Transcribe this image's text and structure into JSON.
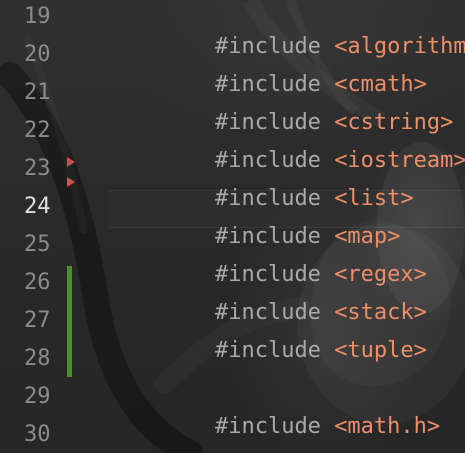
{
  "editor": {
    "theme": {
      "background": "#2a2a2a",
      "line_number": "#8b8b8b",
      "current_line_number": "#e0e0e0",
      "directive": "#a9a9a9",
      "header": "#ec8f67",
      "marker": "#d94b4b",
      "change_bar": "#4f8f2a"
    },
    "lines": [
      {
        "number": "19",
        "directive": "#include",
        "header": "<algorithm>"
      },
      {
        "number": "20",
        "directive": "#include",
        "header": "<cmath>"
      },
      {
        "number": "21",
        "directive": "#include",
        "header": "<cstring>"
      },
      {
        "number": "22",
        "directive": "#include",
        "header": "<iostream>"
      },
      {
        "number": "23",
        "directive": "#include",
        "header": "<list>"
      },
      {
        "number": "24",
        "directive": "#include",
        "header": "<map>"
      },
      {
        "number": "25",
        "directive": "#include",
        "header": "<regex>"
      },
      {
        "number": "26",
        "directive": "#include",
        "header": "<stack>"
      },
      {
        "number": "27",
        "directive": "#include",
        "header": "<tuple>"
      },
      {
        "number": "28",
        "directive": "",
        "header": ""
      },
      {
        "number": "29",
        "directive": "#include",
        "header": "<math.h>"
      },
      {
        "number": "30",
        "directive": "",
        "header": ""
      }
    ],
    "gutter_markers": [
      {
        "line": "23",
        "type": "red-triangle"
      },
      {
        "line": "24",
        "type": "red-triangle"
      }
    ],
    "changed_lines": [
      "26",
      "27",
      "28"
    ],
    "current_line": "24"
  }
}
